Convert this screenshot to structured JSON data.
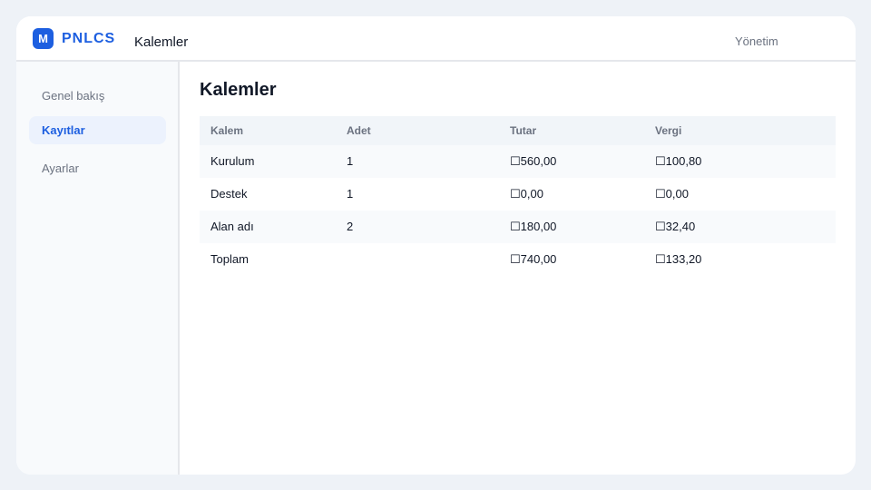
{
  "brand": {
    "logo_letter": "M",
    "name": "PNLCS"
  },
  "header": {
    "title": "Kalemler",
    "right_label": "Yönetim"
  },
  "sidebar": {
    "items": [
      {
        "label": "Genel bakış",
        "active": false
      },
      {
        "label": "Kayıtlar",
        "active": true
      },
      {
        "label": "Ayarlar",
        "active": false
      }
    ]
  },
  "main": {
    "title": "Kalemler",
    "table": {
      "columns": [
        "Kalem",
        "Adet",
        "Tutar",
        "Vergi"
      ],
      "rows": [
        [
          "Kurulum",
          "1",
          "☐560,00",
          "☐100,80"
        ],
        [
          "Destek",
          "1",
          "☐0,00",
          "☐0,00"
        ],
        [
          "Alan adı",
          "2",
          "☐180,00",
          "☐32,40"
        ],
        [
          "Toplam",
          "",
          "☐740,00",
          "☐133,20"
        ]
      ]
    }
  },
  "colors": {
    "accent": "#1d5fe0",
    "background": "#eef2f7",
    "header_row": "#f1f5f9",
    "active_nav": "#ecf2fd"
  }
}
